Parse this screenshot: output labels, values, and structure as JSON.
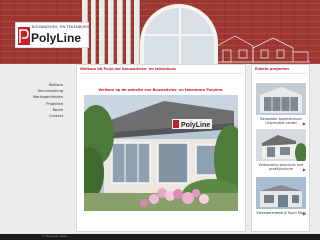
{
  "header": {
    "logo_tagline": "BOUWADVIES- EN TEKENBURO",
    "logo_name": "PolyLine"
  },
  "nav": {
    "items": [
      {
        "label": "Welkom"
      },
      {
        "label": "Kennismaking"
      },
      {
        "label": "Werkzaamheden"
      },
      {
        "label": "Projecten"
      },
      {
        "label": "Route"
      },
      {
        "label": "Contact"
      }
    ]
  },
  "main": {
    "title": "Welkom bij PolyLine bouwadvies- en tekenburo",
    "heading": "Welkom op de website van Bouwadvies- en tekenburo Polyline.",
    "photo_sign": "PolyLine"
  },
  "projects": {
    "title": "Enkele projecten",
    "items": [
      {
        "caption": "Renovatie Sportcentrum Universiteit Leiden"
      },
      {
        "caption": "Verbouwing woonhuis met praktijkruimte"
      },
      {
        "caption": "Vleeswarenbedrijf Topin Mooi"
      }
    ]
  },
  "footer": {
    "text": "© PolyLine 2009"
  },
  "colors": {
    "accent": "#c12226",
    "brick": "#9e3731",
    "background": "#ececec",
    "footer": "#1b1b1b"
  }
}
